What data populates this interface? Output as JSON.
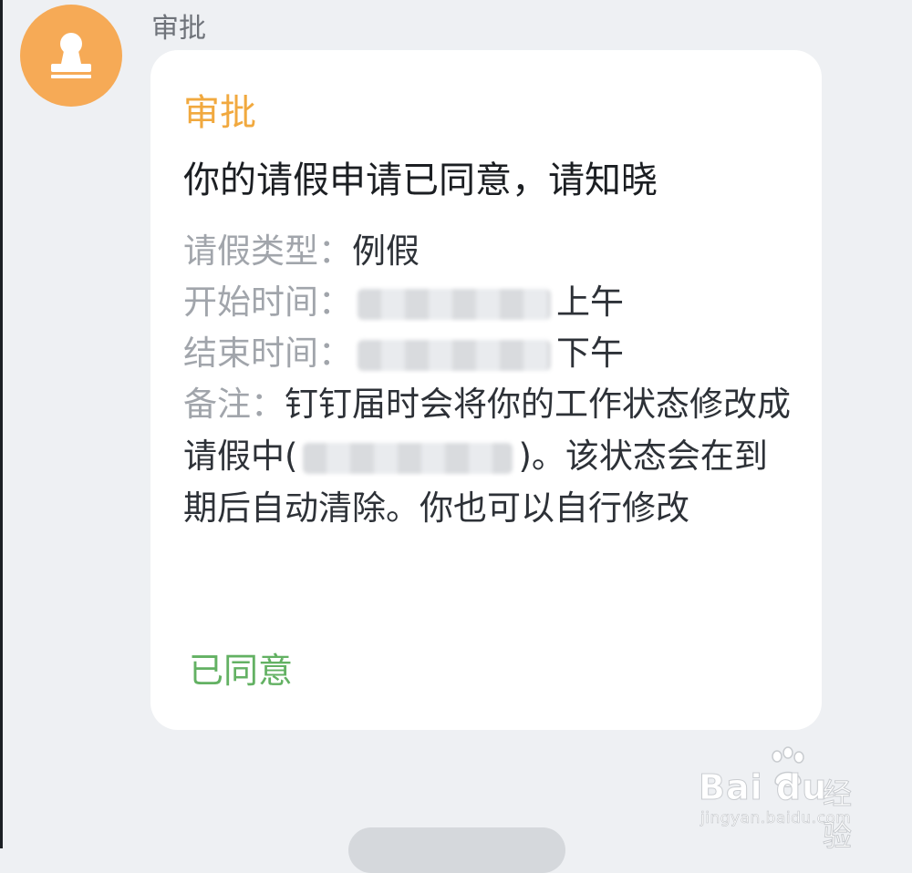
{
  "sender": {
    "name": "审批"
  },
  "card": {
    "title": "审批",
    "headline": "你的请假申请已同意，请知晓",
    "fields": [
      {
        "label": "请假类型：",
        "value": "例假"
      },
      {
        "label": "开始时间：",
        "value": "上午"
      },
      {
        "label": "结束时间：",
        "value": "下午"
      }
    ],
    "note": {
      "label": "备注：",
      "text_before": "钉钉届时会将你的工作状态修改成 请假中(",
      "text_after": ")。该状态会在到期后自动清除。你也可以自行修改"
    },
    "status": "已同意"
  },
  "watermark": {
    "logo": "Bai du",
    "brand": "经验",
    "url": "jingyan.baidu.com"
  },
  "colors": {
    "accent": "#f1a93f",
    "approved": "#63b163",
    "avatar": "#f6aa56"
  },
  "icons": {
    "avatar": "stamp-icon"
  }
}
